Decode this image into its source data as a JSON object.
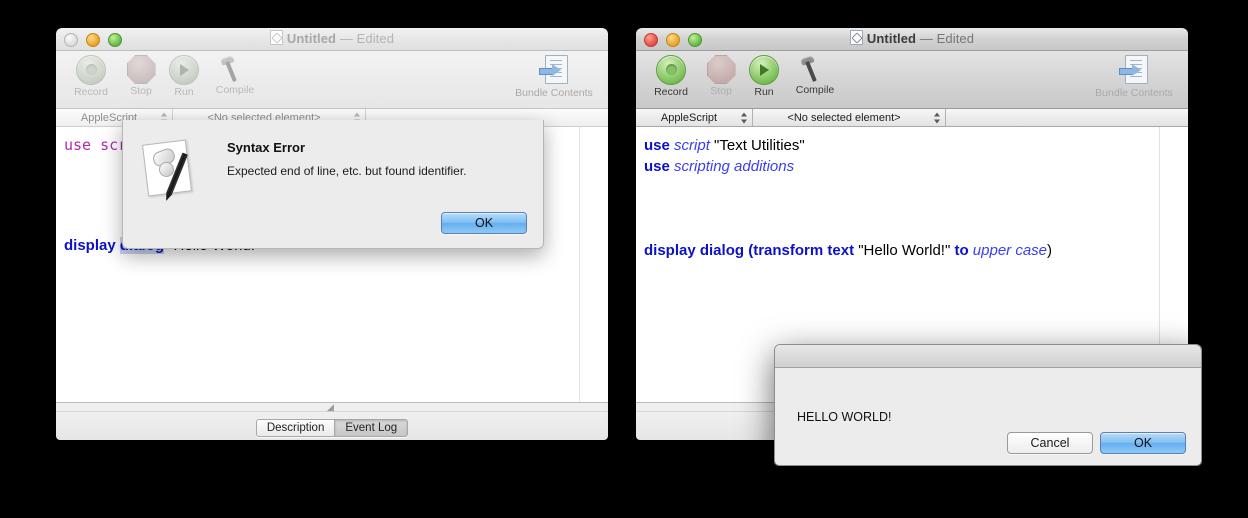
{
  "meta": {
    "bg_color": "#000000"
  },
  "left_window": {
    "active": false,
    "title": "Untitled",
    "title_suffix": "— Edited",
    "toolbar": {
      "items": [
        {
          "label": "Record",
          "icon": "record-circle-icon"
        },
        {
          "label": "Stop",
          "icon": "stop-octagon-icon"
        },
        {
          "label": "Run",
          "icon": "run-play-icon"
        },
        {
          "label": "Compile",
          "icon": "hammer-icon"
        }
      ],
      "bundle": {
        "label": "Bundle Contents",
        "icon": "bundle-contents-icon"
      }
    },
    "navbar": {
      "language": "AppleScript",
      "element": "<No selected element>"
    },
    "code": {
      "line1_raw": "use scripting additions",
      "display_line": {
        "kw1": "display",
        "kw2": "dialog",
        "str": "\"Hello World!\""
      }
    },
    "bottom": {
      "tabs": [
        {
          "label": "Description",
          "selected": false
        },
        {
          "label": "Event Log",
          "selected": true
        }
      ]
    },
    "sheet": {
      "icon": "applescript-document-icon",
      "title": "Syntax Error",
      "message": "Expected end of line, etc. but found identifier.",
      "ok_label": "OK"
    }
  },
  "right_window": {
    "active": true,
    "title": "Untitled",
    "title_suffix": "— Edited",
    "toolbar": {
      "items": [
        {
          "label": "Record",
          "icon": "record-circle-icon"
        },
        {
          "label": "Stop",
          "icon": "stop-octagon-icon"
        },
        {
          "label": "Run",
          "icon": "run-play-icon"
        },
        {
          "label": "Compile",
          "icon": "hammer-icon"
        }
      ],
      "bundle": {
        "label": "Bundle Contents",
        "icon": "bundle-contents-icon"
      }
    },
    "navbar": {
      "language": "AppleScript",
      "element": "<No selected element>"
    },
    "code": {
      "l1_use": "use",
      "l1_term": "script",
      "l1_str": "\"Text Utilities\"",
      "l2_use": "use",
      "l2_term": "scripting additions",
      "l4_kw1": "display dialog",
      "l4_open": " (",
      "l4_kw2": "transform text",
      "l4_str": " \"Hello World!\" ",
      "l4_to": "to",
      "l4_term": " upper case",
      "l4_close": ")"
    }
  },
  "hello_dialog": {
    "message": "HELLO WORLD!",
    "cancel_label": "Cancel",
    "ok_label": "OK"
  }
}
